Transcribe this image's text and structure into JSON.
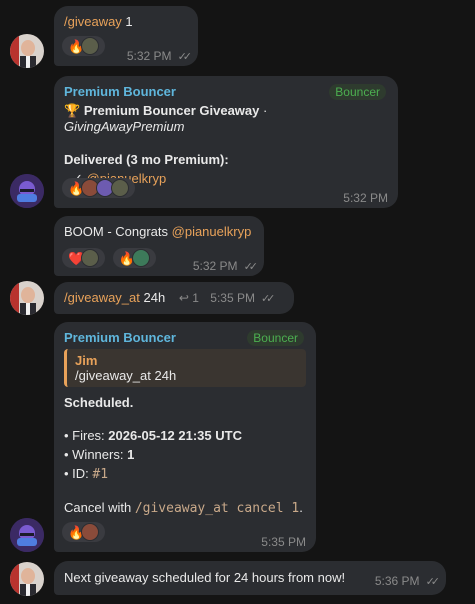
{
  "messages": {
    "m1": {
      "command": "/giveaway",
      "arg": " 1",
      "time": "5:32 PM"
    },
    "m2": {
      "sender": "Premium Bouncer",
      "tag": "Bouncer",
      "title_emoji": "🏆",
      "title": "Premium Bouncer Giveaway",
      "separator": " · ",
      "title_handle": "GivingAwayPremium",
      "delivered": "Delivered (3 mo Premium):",
      "check": "✓",
      "winner": "@pianuelkryp",
      "time": "5:32 PM"
    },
    "m3": {
      "text": "BOOM - Congrats ",
      "mention": "@pianuelkryp",
      "time": "5:32 PM"
    },
    "m4": {
      "command": "/giveaway_at",
      "arg": " 24h",
      "reply_icon": "↩",
      "reply_count": "1",
      "time": "5:35 PM"
    },
    "m5": {
      "sender": "Premium Bouncer",
      "tag": "Bouncer",
      "quote_name": "Jim",
      "quote_text": "/giveaway_at 24h",
      "scheduled": "Scheduled.",
      "fires_label": "• Fires: ",
      "fires_value": "2026-05-12 21:35 UTC",
      "winners_label": "• Winners: ",
      "winners_value": "1",
      "id_label": "• ID: ",
      "id_value": "#1",
      "cancel_prefix": "Cancel with ",
      "cancel_cmd": "/giveaway_at cancel 1",
      "cancel_suffix": ".",
      "time": "5:35 PM"
    },
    "m6": {
      "text": "Next giveaway scheduled for 24 hours from now!",
      "time": "5:36 PM"
    }
  },
  "reactions": {
    "fire": "🔥",
    "heart": "❤️",
    "double_check": "✓✓"
  },
  "colors": {
    "accent": "#e8a25a",
    "sender": "#5fb6dc",
    "tag": "#4caf50",
    "bubble": "#2b2d31",
    "bg": "#141414"
  }
}
